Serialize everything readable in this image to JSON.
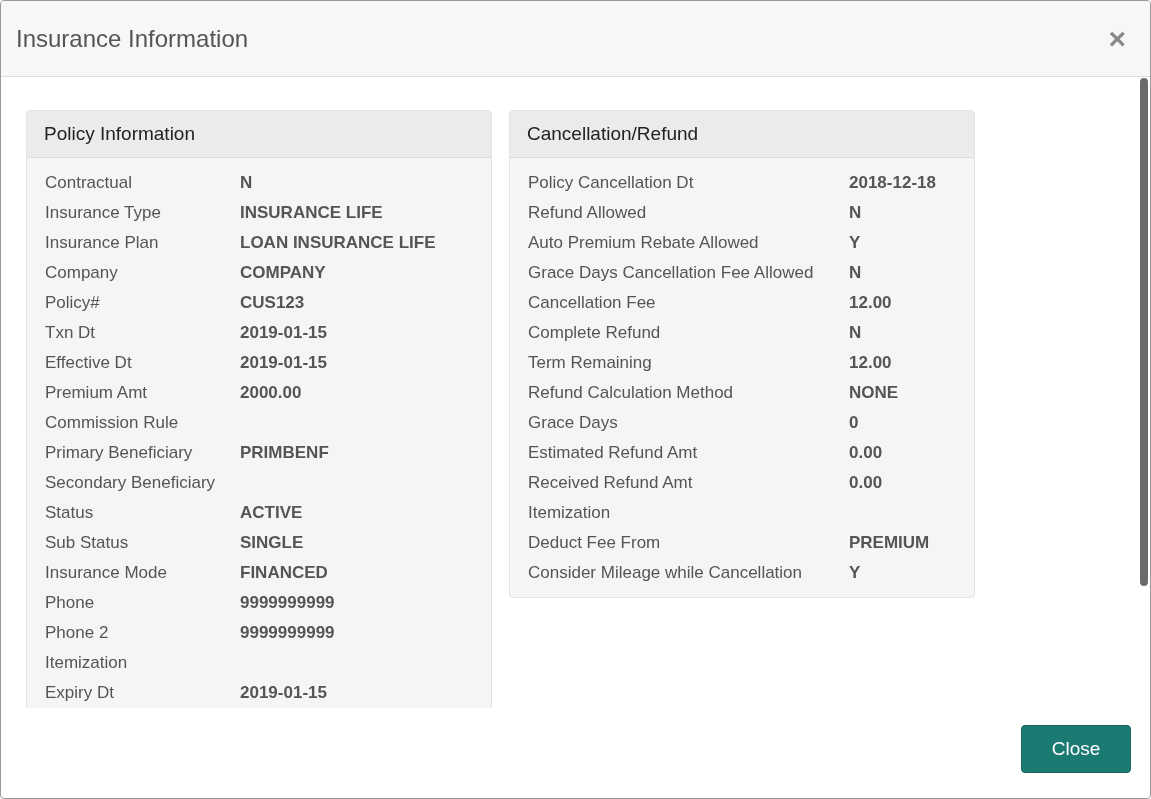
{
  "dialog": {
    "title": "Insurance Information",
    "close_icon": "×"
  },
  "panels": [
    {
      "title": "Policy Information",
      "rows": [
        {
          "label": "Contractual",
          "value": "N"
        },
        {
          "label": "Insurance Type",
          "value": "INSURANCE LIFE"
        },
        {
          "label": "Insurance Plan",
          "value": "LOAN INSURANCE LIFE"
        },
        {
          "label": "Company",
          "value": "COMPANY"
        },
        {
          "label": "Policy#",
          "value": "CUS123"
        },
        {
          "label": "Txn Dt",
          "value": "2019-01-15"
        },
        {
          "label": "Effective Dt",
          "value": "2019-01-15"
        },
        {
          "label": "Premium Amt",
          "value": "2000.00"
        },
        {
          "label": "Commission Rule"
        },
        {
          "label": "Primary Beneficiary",
          "value": "PRIMBENF"
        },
        {
          "label": "Secondary Beneficiary"
        },
        {
          "label": "Status",
          "value": "ACTIVE"
        },
        {
          "label": "Sub Status",
          "value": "SINGLE"
        },
        {
          "label": "Insurance Mode",
          "value": "FINANCED"
        },
        {
          "label": "Phone",
          "value": "9999999999"
        },
        {
          "label": "Phone 2",
          "value": "9999999999"
        },
        {
          "label": "Itemization"
        },
        {
          "label": "Expiry Dt",
          "value": "2019-01-15"
        }
      ]
    },
    {
      "title": "Cancellation/Refund",
      "rows": [
        {
          "label": "Policy Cancellation Dt",
          "value": "2018-12-18"
        },
        {
          "label": "Refund Allowed",
          "value": "N"
        },
        {
          "label": "Auto Premium Rebate Allowed",
          "value": "Y"
        },
        {
          "label": "Grace Days Cancellation Fee Allowed",
          "value": "N"
        },
        {
          "label": "Cancellation Fee",
          "value": "12.00"
        },
        {
          "label": "Complete Refund",
          "value": "N"
        },
        {
          "label": "Term Remaining",
          "value": "12.00"
        },
        {
          "label": "Refund Calculation Method",
          "value": "NONE"
        },
        {
          "label": "Grace Days",
          "value": "0"
        },
        {
          "label": "Estimated Refund Amt",
          "value": "0.00"
        },
        {
          "label": "Received Refund Amt",
          "value": "0.00"
        },
        {
          "label": "Itemization"
        },
        {
          "label": "Deduct Fee From",
          "value": "PREMIUM"
        },
        {
          "label": "Consider Mileage while Cancellation",
          "value": "Y"
        }
      ]
    }
  ],
  "footer": {
    "button": "Close"
  }
}
